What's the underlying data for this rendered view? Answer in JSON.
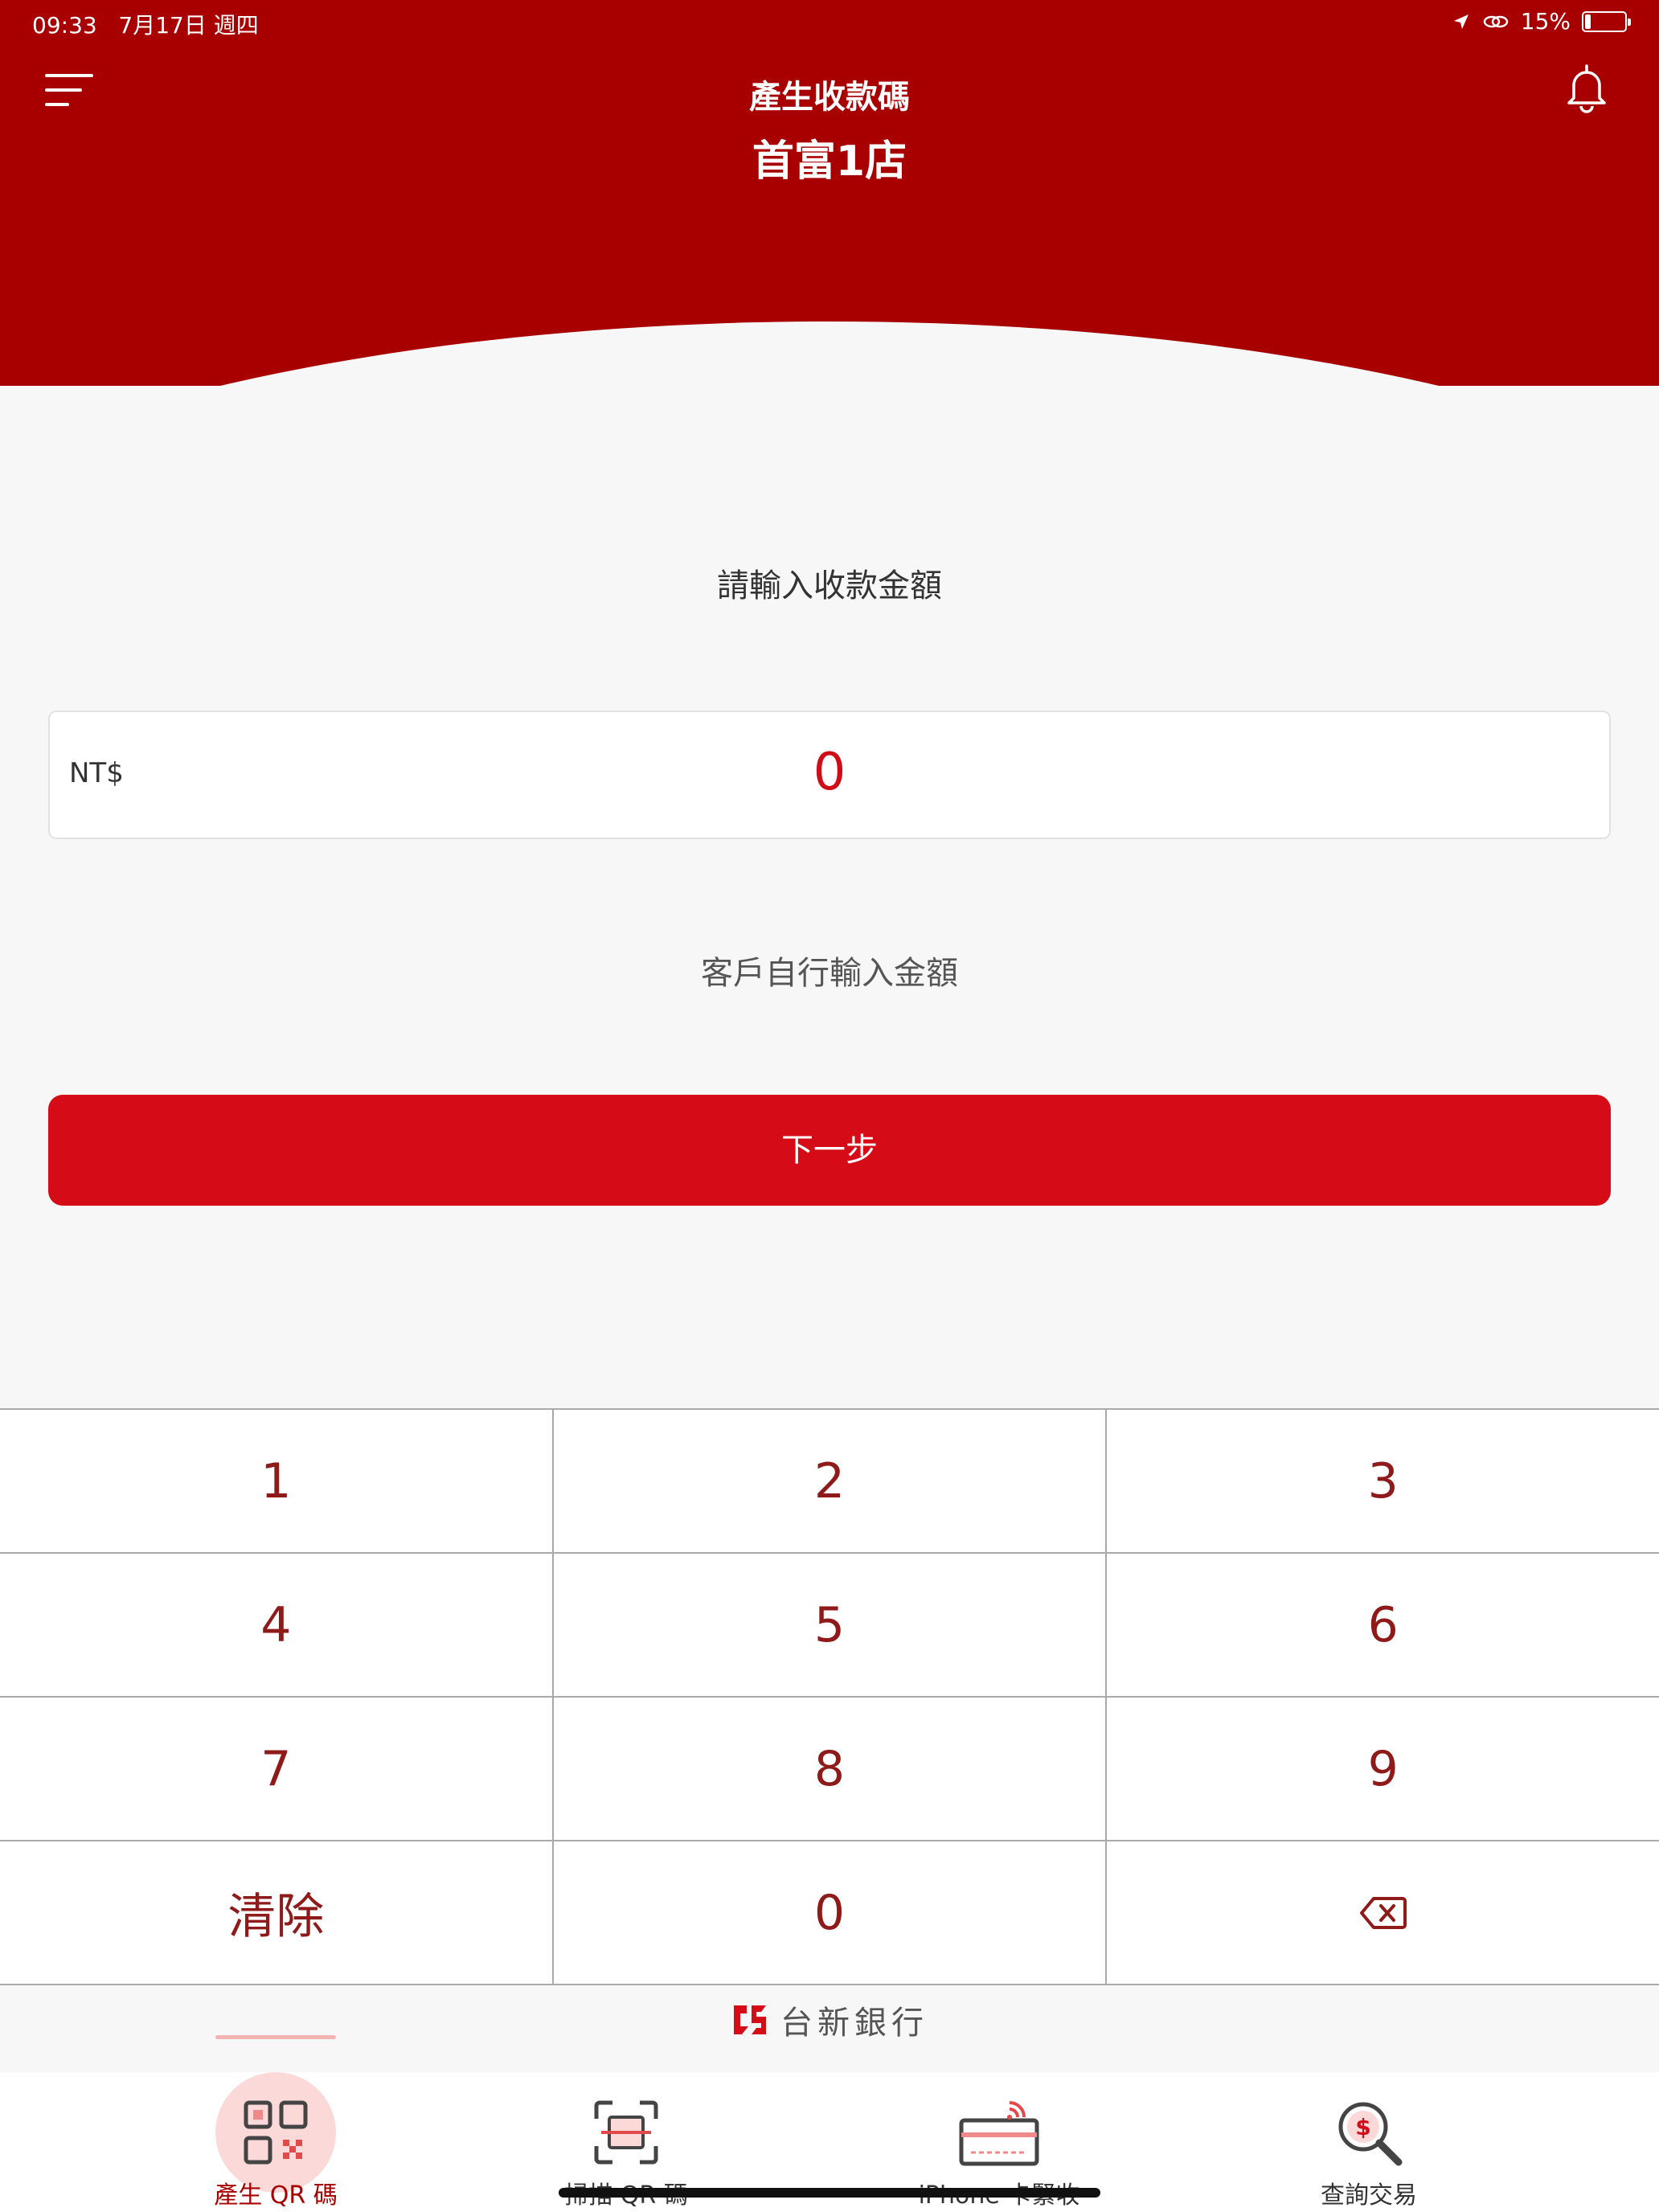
{
  "status_bar": {
    "time": "09:33",
    "date": "7月17日 週四",
    "battery": "15%",
    "battery_level": 0.15
  },
  "header": {
    "title": "產生收款碼",
    "subtitle": "首富1店"
  },
  "main": {
    "prompt": "請輸入收款金額",
    "currency": "NT$",
    "amount": "0",
    "self_input_label": "客戶自行輸入金額",
    "next_button": "下一步"
  },
  "keypad": {
    "keys": [
      "1",
      "2",
      "3",
      "4",
      "5",
      "6",
      "7",
      "8",
      "9",
      "清除",
      "0"
    ],
    "backspace_icon": "backspace-icon"
  },
  "brand": {
    "name": "台新銀行",
    "logo_icon": "taishin-logo-icon"
  },
  "tabbar": {
    "tabs": [
      {
        "label": "產生 QR 碼",
        "icon": "qr-code-icon",
        "active": true
      },
      {
        "label": "掃描 QR 碼",
        "icon": "scan-qr-icon",
        "active": false
      },
      {
        "label": "iPhone 卡緊收",
        "icon": "tap-card-icon",
        "active": false
      },
      {
        "label": "查詢交易",
        "icon": "search-dollar-icon",
        "active": false
      }
    ]
  },
  "colors": {
    "header_red": "#a80000",
    "accent_red": "#d50b17",
    "key_text": "#8e1a1a"
  }
}
